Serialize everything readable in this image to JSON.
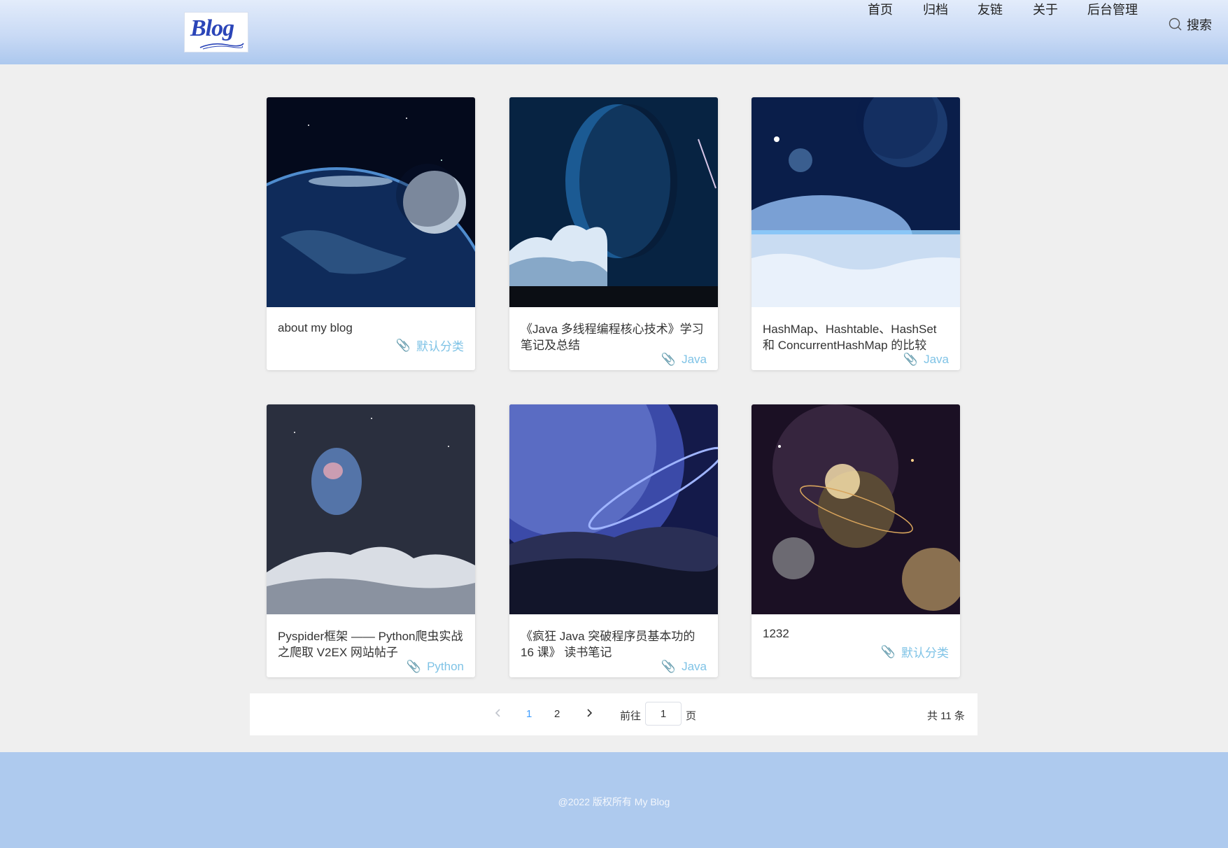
{
  "header": {
    "logo_text": "Blog",
    "nav": [
      "首页",
      "归档",
      "友链",
      "关于",
      "后台管理"
    ],
    "search_label": "搜索"
  },
  "posts": [
    {
      "title": "about my blog",
      "category": "默认分类"
    },
    {
      "title": "《Java 多线程编程核心技术》学习笔记及总结",
      "category": "Java"
    },
    {
      "title": "HashMap、Hashtable、HashSet 和 ConcurrentHashMap 的比较",
      "category": "Java"
    },
    {
      "title": "Pyspider框架 —— Python爬虫实战之爬取 V2EX 网站帖子",
      "category": "Python"
    },
    {
      "title": "《疯狂 Java 突破程序员基本功的 16 课》 读书笔记",
      "category": "Java"
    },
    {
      "title": "1232",
      "category": "默认分类"
    }
  ],
  "pagination": {
    "pages": [
      "1",
      "2"
    ],
    "current": "1",
    "goto_prefix": "前往",
    "goto_value": "1",
    "goto_suffix": "页",
    "total": "共 11 条"
  },
  "footer": {
    "copyright": "@2022  版权所有 My Blog"
  },
  "colors": {
    "accent": "#409eff",
    "category": "#7fc3e6",
    "footer_bg": "#aecaee"
  }
}
